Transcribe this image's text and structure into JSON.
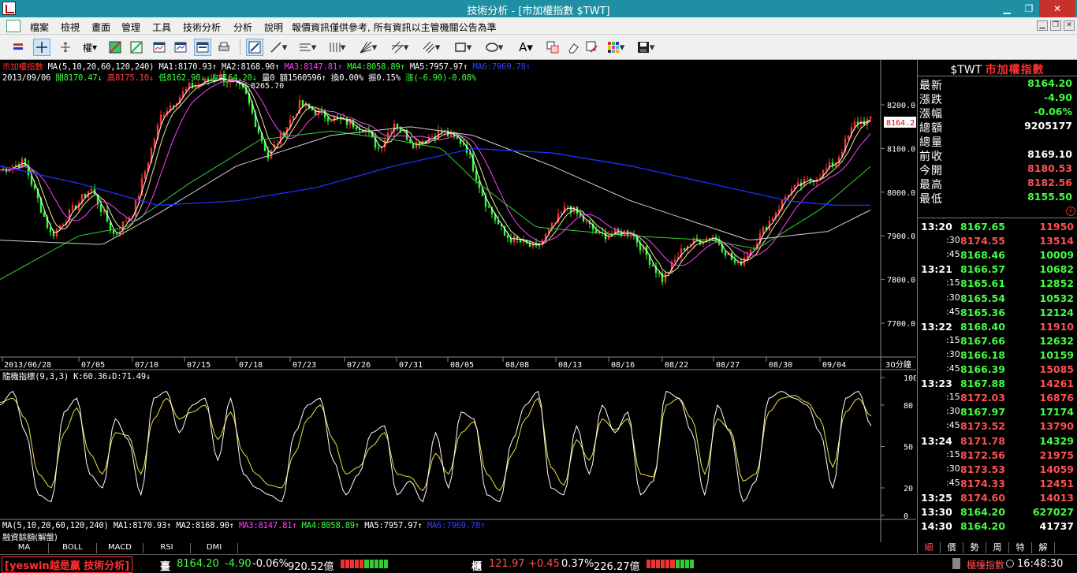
{
  "window": {
    "title": "技術分析 - [市加權指數 $TWT]"
  },
  "menu": [
    "檔案",
    "檢視",
    "畫面",
    "管理",
    "工具",
    "技術分析",
    "分析",
    "說明",
    "報價資訊僅供參考, 所有資訊以主管機關公告為準"
  ],
  "toolbar": {
    "weight_label": "權"
  },
  "legend": {
    "line1": [
      {
        "t": "市加權指數",
        "c": "#ff3030"
      },
      {
        "t": "MA(5,10,20,60,120,240)",
        "c": "#ffffff"
      },
      {
        "t": "MA1:8170.93↑",
        "c": "#ffffff"
      },
      {
        "t": "MA2:8168.90↑",
        "c": "#ffffff"
      },
      {
        "t": "MA3:8147.81↑",
        "c": "#ff40ff"
      },
      {
        "t": "MA4:8058.89↑",
        "c": "#40ff40"
      },
      {
        "t": "MA5:7957.97↑",
        "c": "#ffffff"
      },
      {
        "t": "MA6:7969.78↑",
        "c": "#3040ff"
      }
    ],
    "line2": [
      {
        "t": "2013/09/06",
        "c": "#ffffff"
      },
      {
        "t": "開8170.47↓",
        "c": "#40ff40"
      },
      {
        "t": "高8175.10↓",
        "c": "#ff4040"
      },
      {
        "t": "低8162.98↓",
        "c": "#40ff40"
      },
      {
        "t": "收8164.20↓",
        "c": "#40ff40"
      },
      {
        "t": "量0",
        "c": "#ffffff"
      },
      {
        "t": "額1560596↑",
        "c": "#ffffff"
      },
      {
        "t": "換0.00%",
        "c": "#ffffff"
      },
      {
        "t": "振0.15%",
        "c": "#ffffff"
      },
      {
        "t": "漲(-6.90)-0.08%",
        "c": "#40ff40"
      }
    ],
    "kd": "隨機指標(9,3,3) K:60.36↓D:71.49↓",
    "bottom_ma": [
      {
        "t": "MA(5,10,20,60,120,240)",
        "c": "#ffffff"
      },
      {
        "t": "MA1:8170.93↑",
        "c": "#ffffff"
      },
      {
        "t": "MA2:8168.90↑",
        "c": "#ffffff"
      },
      {
        "t": "MA3:8147.81↑",
        "c": "#ff40ff"
      },
      {
        "t": "MA4:8058.89↑",
        "c": "#40ff40"
      },
      {
        "t": "MA5:7957.97↑",
        "c": "#ffffff"
      },
      {
        "t": "MA6:7969.78↑",
        "c": "#3040ff"
      }
    ],
    "margin": "融資餘額(解盤)"
  },
  "chart_data": {
    "type": "line",
    "x_dates": [
      "2013/06/28",
      "07/05",
      "07/10",
      "07/15",
      "07/18",
      "07/23",
      "07/26",
      "07/31",
      "08/05",
      "08/08",
      "08/13",
      "08/16",
      "08/22",
      "08/27",
      "08/30",
      "09/04"
    ],
    "period": "30分鐘",
    "y_ticks": [
      "8200.0",
      "8100.0",
      "8000.0",
      "7900.0",
      "7800.0",
      "7700.0"
    ],
    "ylim": [
      7700,
      8200
    ],
    "peak_label": "8265.70",
    "current_label": "8164.2",
    "kd_ticks": [
      "100",
      "80",
      "50",
      "20",
      "0"
    ],
    "kd_ylim": [
      0,
      100
    ],
    "price_kp": [
      [
        0,
        8050
      ],
      [
        30,
        8070
      ],
      [
        65,
        7900
      ],
      [
        115,
        8010
      ],
      [
        145,
        7900
      ],
      [
        170,
        7960
      ],
      [
        205,
        8180
      ],
      [
        240,
        8240
      ],
      [
        280,
        8265
      ],
      [
        310,
        8230
      ],
      [
        340,
        8080
      ],
      [
        380,
        8200
      ],
      [
        420,
        8170
      ],
      [
        460,
        8150
      ],
      [
        480,
        8100
      ],
      [
        500,
        8160
      ],
      [
        525,
        8110
      ],
      [
        560,
        8140
      ],
      [
        590,
        8110
      ],
      [
        615,
        7980
      ],
      [
        640,
        7900
      ],
      [
        680,
        7870
      ],
      [
        720,
        7970
      ],
      [
        760,
        7900
      ],
      [
        800,
        7910
      ],
      [
        840,
        7800
      ],
      [
        870,
        7880
      ],
      [
        905,
        7900
      ],
      [
        935,
        7830
      ],
      [
        960,
        7890
      ],
      [
        1000,
        8000
      ],
      [
        1040,
        8040
      ],
      [
        1060,
        8070
      ],
      [
        1085,
        8160
      ],
      [
        1105,
        8164
      ]
    ],
    "ma_long_kp": [
      [
        0,
        8060
      ],
      [
        100,
        8020
      ],
      [
        200,
        7970
      ],
      [
        300,
        7980
      ],
      [
        400,
        8010
      ],
      [
        500,
        8060
      ],
      [
        600,
        8100
      ],
      [
        700,
        8090
      ],
      [
        800,
        8060
      ],
      [
        900,
        8020
      ],
      [
        1000,
        7980
      ],
      [
        1060,
        7970
      ],
      [
        1105,
        7970
      ]
    ],
    "ma120_kp": [
      [
        0,
        7890
      ],
      [
        130,
        7880
      ],
      [
        200,
        7950
      ],
      [
        300,
        8060
      ],
      [
        420,
        8130
      ],
      [
        520,
        8150
      ],
      [
        600,
        8130
      ],
      [
        700,
        8060
      ],
      [
        800,
        7980
      ],
      [
        900,
        7920
      ],
      [
        950,
        7890
      ],
      [
        1050,
        7910
      ],
      [
        1105,
        7960
      ]
    ],
    "ma60_kp": [
      [
        0,
        7800
      ],
      [
        100,
        7900
      ],
      [
        160,
        7920
      ],
      [
        240,
        8020
      ],
      [
        330,
        8120
      ],
      [
        420,
        8140
      ],
      [
        500,
        8120
      ],
      [
        560,
        8100
      ],
      [
        600,
        8030
      ],
      [
        680,
        7920
      ],
      [
        800,
        7900
      ],
      [
        900,
        7890
      ],
      [
        960,
        7870
      ],
      [
        1040,
        7960
      ],
      [
        1105,
        8060
      ]
    ],
    "kd_k": [
      80,
      90,
      60,
      15,
      10,
      75,
      85,
      30,
      20,
      70,
      55,
      15,
      85,
      90,
      60,
      80,
      85,
      40,
      85,
      30,
      20,
      15,
      10,
      60,
      80,
      85,
      40,
      15,
      30,
      60,
      65,
      15,
      25,
      10,
      60,
      20,
      75,
      70,
      15,
      10,
      55,
      80,
      90,
      20,
      15,
      65,
      30,
      80,
      60,
      75,
      15,
      25,
      90,
      85,
      60,
      15,
      80,
      60,
      10,
      25,
      85,
      90,
      85,
      80,
      60,
      20,
      85,
      90,
      65
    ],
    "kd_d": [
      82,
      85,
      70,
      30,
      20,
      60,
      78,
      45,
      30,
      60,
      58,
      30,
      70,
      85,
      70,
      75,
      80,
      55,
      75,
      45,
      30,
      22,
      20,
      45,
      70,
      80,
      55,
      30,
      35,
      50,
      60,
      30,
      28,
      18,
      45,
      30,
      60,
      68,
      30,
      18,
      45,
      70,
      85,
      35,
      22,
      55,
      40,
      70,
      62,
      70,
      30,
      28,
      80,
      85,
      70,
      30,
      70,
      62,
      25,
      30,
      75,
      85,
      87,
      82,
      70,
      35,
      75,
      85,
      72
    ]
  },
  "quote": {
    "symbol": "$TWT",
    "name": "市加權指數",
    "rows": [
      {
        "label": "最新",
        "value": "8164.20",
        "color": "#40ff40"
      },
      {
        "label": "漲跌",
        "value": "-4.90",
        "color": "#40ff40"
      },
      {
        "label": "漲幅",
        "value": "-0.06%",
        "color": "#40ff40"
      },
      {
        "label": "總額",
        "value": "9205177",
        "color": "#ffffff"
      },
      {
        "label": "總量",
        "value": "",
        "color": "#ffffff"
      },
      {
        "label": "前收",
        "value": "8169.10",
        "color": "#ffffff"
      },
      {
        "label": "今開",
        "value": "8180.53",
        "color": "#ff5050"
      },
      {
        "label": "最高",
        "value": "8182.56",
        "color": "#ff5050"
      },
      {
        "label": "最低",
        "value": "8155.50",
        "color": "#40ff40"
      }
    ],
    "ticks": [
      {
        "time": "13:20",
        "price": "8167.65",
        "vol": "11950",
        "pc": "#40ff40",
        "vc": "#ff5050"
      },
      {
        "time": ":30",
        "price": "8174.55",
        "vol": "13514",
        "pc": "#ff5050",
        "vc": "#ff5050"
      },
      {
        "time": ":45",
        "price": "8168.46",
        "vol": "10009",
        "pc": "#40ff40",
        "vc": "#40ff40"
      },
      {
        "time": "13:21",
        "price": "8166.57",
        "vol": "10682",
        "pc": "#40ff40",
        "vc": "#40ff40"
      },
      {
        "time": ":15",
        "price": "8165.61",
        "vol": "12852",
        "pc": "#40ff40",
        "vc": "#40ff40"
      },
      {
        "time": ":30",
        "price": "8165.54",
        "vol": "10532",
        "pc": "#40ff40",
        "vc": "#40ff40"
      },
      {
        "time": ":45",
        "price": "8165.36",
        "vol": "12124",
        "pc": "#40ff40",
        "vc": "#40ff40"
      },
      {
        "time": "13:22",
        "price": "8168.40",
        "vol": "11910",
        "pc": "#40ff40",
        "vc": "#ff5050"
      },
      {
        "time": ":15",
        "price": "8167.66",
        "vol": "12632",
        "pc": "#40ff40",
        "vc": "#40ff40"
      },
      {
        "time": ":30",
        "price": "8166.18",
        "vol": "10159",
        "pc": "#40ff40",
        "vc": "#40ff40"
      },
      {
        "time": ":45",
        "price": "8166.39",
        "vol": "15085",
        "pc": "#40ff40",
        "vc": "#ff5050"
      },
      {
        "time": "13:23",
        "price": "8167.88",
        "vol": "14261",
        "pc": "#40ff40",
        "vc": "#ff5050"
      },
      {
        "time": ":15",
        "price": "8172.03",
        "vol": "16876",
        "pc": "#ff5050",
        "vc": "#ff5050"
      },
      {
        "time": ":30",
        "price": "8167.97",
        "vol": "17174",
        "pc": "#40ff40",
        "vc": "#40ff40"
      },
      {
        "time": ":45",
        "price": "8173.52",
        "vol": "13790",
        "pc": "#ff5050",
        "vc": "#ff5050"
      },
      {
        "time": "13:24",
        "price": "8171.78",
        "vol": "14329",
        "pc": "#ff5050",
        "vc": "#40ff40"
      },
      {
        "time": ":15",
        "price": "8172.56",
        "vol": "21975",
        "pc": "#ff5050",
        "vc": "#ff5050"
      },
      {
        "time": ":30",
        "price": "8173.53",
        "vol": "14059",
        "pc": "#ff5050",
        "vc": "#ff5050"
      },
      {
        "time": ":45",
        "price": "8174.33",
        "vol": "12451",
        "pc": "#ff5050",
        "vc": "#ff5050"
      },
      {
        "time": "13:25",
        "price": "8174.60",
        "vol": "14013",
        "pc": "#ff5050",
        "vc": "#ff5050"
      },
      {
        "time": "13:30",
        "price": "8164.20",
        "vol": "627027",
        "pc": "#40ff40",
        "vc": "#40ff40"
      },
      {
        "time": "14:30",
        "price": "8164.20",
        "vol": "41737",
        "pc": "#40ff40",
        "vc": "#ffffff"
      }
    ]
  },
  "bottom_tabs": [
    "MA",
    "BOLL",
    "MACD",
    "RSI",
    "DMI"
  ],
  "panel_tabs": [
    "細",
    "價",
    "勢",
    "周",
    "特",
    "解"
  ],
  "status": {
    "brand": "[yeswin越是贏 技術分析]",
    "idx_label": "臺",
    "idx_value": "8164.20",
    "idx_change": "-4.90",
    "idx_pct": "-0.06%",
    "idx_amt": "920.52億",
    "otc_label": "櫃",
    "otc_value": "121.97",
    "otc_change": "+0.45",
    "otc_pct": "0.37%",
    "otc_amt": "226.27億",
    "right_label": "櫃檯指數",
    "time": "16:48:30"
  }
}
